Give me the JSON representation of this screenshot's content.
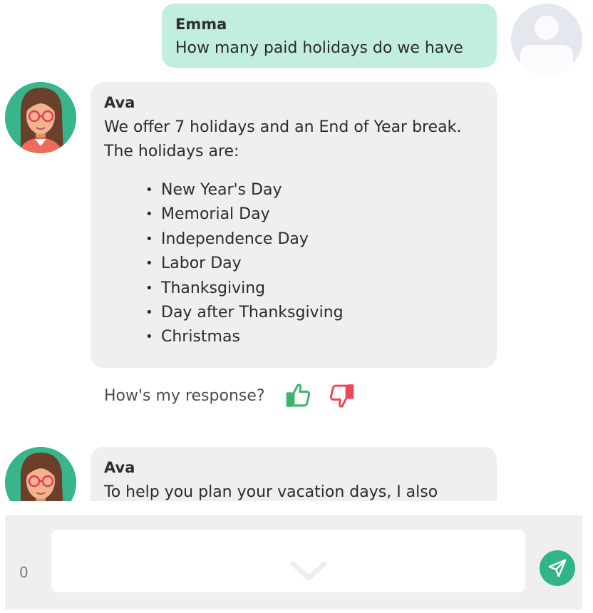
{
  "colors": {
    "user_bubble": "#c2eedd",
    "bot_bubble": "#efefef",
    "accent_green": "#31b487",
    "thumbs_up": "#3cb56b",
    "thumbs_down": "#e94a57"
  },
  "messages": [
    {
      "sender": "Emma",
      "role": "user",
      "text": "How many paid holidays do we have",
      "avatar_icon": "user-placeholder-icon"
    },
    {
      "sender": "Ava",
      "role": "bot",
      "intro": "We offer 7 holidays and an End of Year break. The holidays are:",
      "holidays": [
        "New Year's Day",
        "Memorial Day",
        "Independence Day",
        "Labor Day",
        "Thanksgiving",
        "Day after Thanksgiving",
        "Christmas"
      ]
    },
    {
      "sender": "Ava",
      "role": "bot",
      "text": "To help you plan your vacation days, I also"
    }
  ],
  "feedback": {
    "prompt": "How's my response?",
    "up_icon": "thumbs-up-icon",
    "down_icon": "thumbs-down-icon"
  },
  "composer": {
    "char_count": "0",
    "input_value": "",
    "input_placeholder": "",
    "scroll_icon": "chevron-down-icon",
    "send_icon": "send-icon"
  }
}
